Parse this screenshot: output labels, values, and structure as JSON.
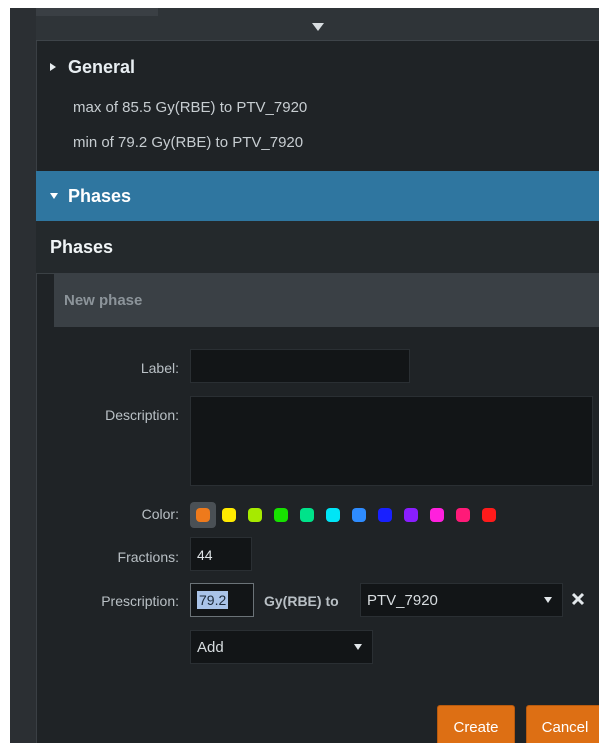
{
  "general": {
    "title": "General",
    "lines": [
      "max of 85.5 Gy(RBE) to PTV_7920",
      "min of 79.2 Gy(RBE) to PTV_7920"
    ]
  },
  "phases_section": {
    "title": "Phases",
    "subheader": "Phases"
  },
  "new_phase": {
    "title": "New phase",
    "labels": {
      "label": "Label:",
      "description": "Description:",
      "color": "Color:",
      "fractions": "Fractions:",
      "prescription": "Prescription:"
    },
    "values": {
      "label": "",
      "description": "",
      "fractions": "44",
      "prescription_dose": "79.2",
      "prescription_unit": "Gy(RBE) to",
      "target": "PTV_7920",
      "add_select": "Add"
    },
    "colors": [
      "#ee7a1c",
      "#ffea00",
      "#a6ea00",
      "#17e100",
      "#00e38a",
      "#00e5f6",
      "#2e8cff",
      "#1820ff",
      "#8a1eff",
      "#ff20dd",
      "#ff1a78",
      "#ff1b1b"
    ],
    "buttons": {
      "create": "Create",
      "cancel": "Cancel"
    },
    "icons": {
      "remove_target": "close-icon"
    }
  }
}
